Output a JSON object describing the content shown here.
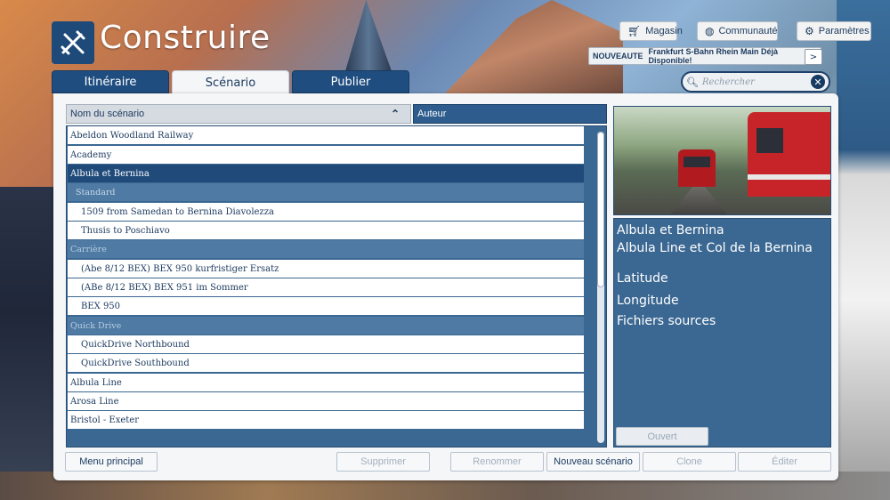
{
  "header": {
    "title": "Construire"
  },
  "top_buttons": [
    {
      "label": "Magasin",
      "icon": "cart-icon"
    },
    {
      "label": "Communauté",
      "icon": "globe-icon"
    },
    {
      "label": "Paramètres",
      "icon": "gear-icon"
    }
  ],
  "news": {
    "tag": "NOUVEAUTE",
    "text": "Frankfurt S-Bahn Rhein Main Déjà Disponible!",
    "next": ">"
  },
  "tabs": [
    {
      "label": "Itinéraire",
      "active": false
    },
    {
      "label": "Scénario",
      "active": true
    },
    {
      "label": "Publier",
      "active": false
    }
  ],
  "search": {
    "placeholder": "Rechercher"
  },
  "columns": {
    "name": "Nom du scénario",
    "author": "Auteur"
  },
  "list": [
    {
      "text": "Abeldon Woodland Railway",
      "kind": "item"
    },
    {
      "text": "Academy",
      "kind": "item"
    },
    {
      "text": "Albula et Bernina",
      "kind": "selected"
    },
    {
      "text": "Standard",
      "kind": "group"
    },
    {
      "text": "1509 from Samedan to Bernina Diavolezza",
      "kind": "sub"
    },
    {
      "text": "Thusis to Poschiavo",
      "kind": "sub"
    },
    {
      "text": "Carrière",
      "kind": "group-top"
    },
    {
      "text": "(Abe 8/12 BEX)  BEX 950 kurfristiger Ersatz",
      "kind": "sub"
    },
    {
      "text": "(ABe 8/12 BEX) BEX 951 im Sommer",
      "kind": "sub"
    },
    {
      "text": "BEX 950",
      "kind": "sub"
    },
    {
      "text": "Quick Drive",
      "kind": "group-top"
    },
    {
      "text": "QuickDrive Northbound",
      "kind": "sub"
    },
    {
      "text": "QuickDrive Southbound",
      "kind": "sub"
    },
    {
      "text": "Albula Line",
      "kind": "item"
    },
    {
      "text": "Arosa Line",
      "kind": "item"
    },
    {
      "text": "Bristol - Exeter",
      "kind": "item"
    }
  ],
  "details": {
    "route": "Albula et Bernina",
    "scenario": "Albula Line et Col de la Bernina",
    "latitude": "Latitude",
    "longitude": "Longitude",
    "sources": "Fichiers sources",
    "open_button": "Ouvert"
  },
  "bottom_buttons": [
    {
      "label": "Menu principal",
      "enabled": true
    },
    {
      "label": "Supprimer",
      "enabled": false
    },
    {
      "label": "Renommer",
      "enabled": false
    },
    {
      "label": "Nouveau scénario",
      "enabled": true
    },
    {
      "label": "Clone",
      "enabled": false
    },
    {
      "label": "Éditer",
      "enabled": false
    }
  ]
}
